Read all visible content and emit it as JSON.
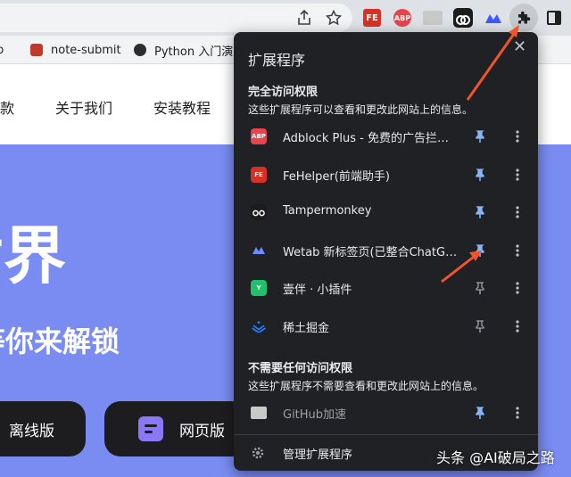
{
  "toolbar": {
    "extension_icons": [
      "share-icon",
      "bookmark-star-icon",
      "fehelper-icon",
      "adblock-plus-icon",
      "github-accelerate-icon",
      "tampermonkey-icon",
      "wetab-icon",
      "extensions-puzzle-icon",
      "side-panel-icon"
    ],
    "fe_badge": "FE",
    "abp_badge": "ABP"
  },
  "bookmarks": {
    "items": [
      {
        "label": "b"
      },
      {
        "label": "note-submit"
      },
      {
        "label": "Python 入门演示"
      }
    ]
  },
  "site": {
    "nav": [
      "款",
      "关于我们",
      "安装教程"
    ],
    "hero_title": "世界",
    "hero_subtitle": "等你来解锁",
    "buttons": {
      "offline": "离线版",
      "web": "网页版"
    }
  },
  "popup": {
    "title": "扩展程序",
    "close": "✕",
    "full_access": {
      "heading": "完全访问权限",
      "description": "这些扩展程序可以查看和更改此网站上的信息。",
      "items": [
        {
          "name": "Adblock Plus - 免费的广告拦截器",
          "icon": "adblock-plus-icon",
          "badge": "ABP",
          "color": "#e8434c",
          "pinned": true
        },
        {
          "name": "FeHelper(前端助手)",
          "icon": "fehelper-icon",
          "badge": "FE",
          "color": "#d93025",
          "pinned": true
        },
        {
          "name": "Tampermonkey",
          "icon": "tampermonkey-icon",
          "badge": "",
          "color": "#1c1c1c",
          "pinned": true
        },
        {
          "name": "Wetab 新标签页(已整合ChatGPT)",
          "icon": "wetab-icon",
          "badge": "",
          "color": "#202124",
          "pinned": true
        },
        {
          "name": "壹伴 · 小插件",
          "icon": "yiban-icon",
          "badge": "Y",
          "color": "#1fc16b",
          "pinned": false
        },
        {
          "name": "稀土掘金",
          "icon": "juejin-icon",
          "badge": "",
          "color": "#202124",
          "pinned": false
        }
      ]
    },
    "no_access": {
      "heading": "不需要任何访问权限",
      "description": "这些扩展程序不需要查看和更改此网站上的信息。",
      "items": [
        {
          "name": "GitHub加速",
          "icon": "github-accelerate-icon",
          "badge": "",
          "color": "#c9c9c9",
          "pinned": true
        }
      ]
    },
    "manage_label": "管理扩展程序"
  },
  "colors": {
    "popup_bg": "#202124",
    "pin_active": "#8ab4f8",
    "hero_bg": "#7a8cf2",
    "arrow": "#f0542d"
  },
  "watermark": "头条 @AI破局之路"
}
